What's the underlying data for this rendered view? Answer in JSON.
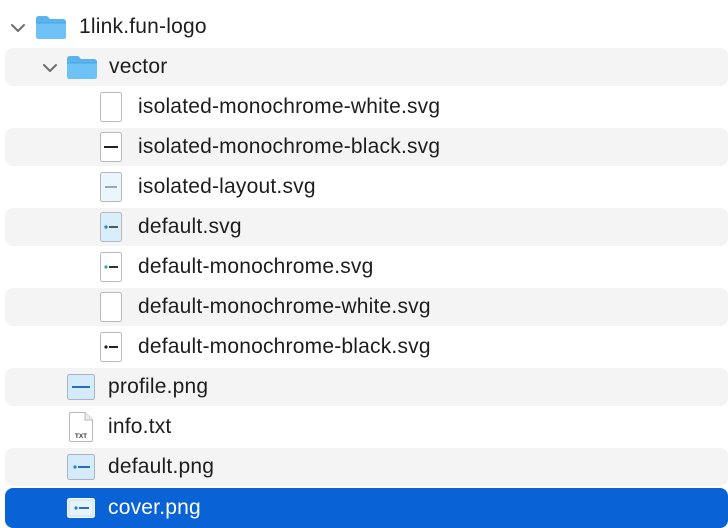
{
  "tree": {
    "root": {
      "label": "1link.fun-logo",
      "expanded": true
    },
    "vector": {
      "label": "vector",
      "expanded": true
    },
    "vector_files": [
      {
        "label": "isolated-monochrome-white.svg",
        "icon": "svg-file-white-icon"
      },
      {
        "label": "isolated-monochrome-black.svg",
        "icon": "svg-file-black-logo-icon"
      },
      {
        "label": "isolated-layout.svg",
        "icon": "svg-file-layout-icon"
      },
      {
        "label": "default.svg",
        "icon": "svg-file-default-icon"
      },
      {
        "label": "default-monochrome.svg",
        "icon": "svg-file-monochrome-icon"
      },
      {
        "label": "default-monochrome-white.svg",
        "icon": "svg-file-white-icon"
      },
      {
        "label": "default-monochrome-black.svg",
        "icon": "svg-file-black-logo-icon"
      }
    ],
    "files": [
      {
        "label": "profile.png",
        "icon": "png-image-icon"
      },
      {
        "label": "info.txt",
        "icon": "txt-file-icon",
        "badge": "TXT"
      },
      {
        "label": "default.png",
        "icon": "png-image-icon"
      },
      {
        "label": "cover.png",
        "icon": "png-cover-icon",
        "selected": true
      }
    ]
  },
  "colors": {
    "folder": "#5cb8f0",
    "selection": "#0a63d6",
    "alt_row": "#f4f4f5"
  }
}
